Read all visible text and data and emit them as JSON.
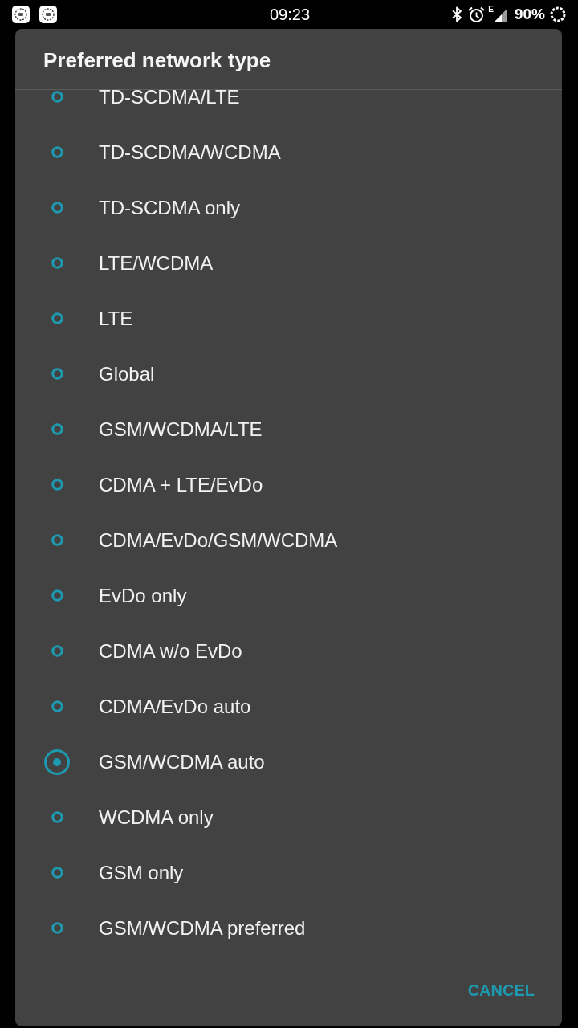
{
  "status_bar": {
    "time": "09:23",
    "network_type": "E",
    "battery": "90%"
  },
  "dialog": {
    "title": "Preferred network type",
    "options": [
      {
        "label": "TD-SCDMA/LTE",
        "selected": false
      },
      {
        "label": "TD-SCDMA/WCDMA",
        "selected": false
      },
      {
        "label": "TD-SCDMA only",
        "selected": false
      },
      {
        "label": "LTE/WCDMA",
        "selected": false
      },
      {
        "label": "LTE",
        "selected": false
      },
      {
        "label": "Global",
        "selected": false
      },
      {
        "label": "GSM/WCDMA/LTE",
        "selected": false
      },
      {
        "label": "CDMA + LTE/EvDo",
        "selected": false
      },
      {
        "label": "CDMA/EvDo/GSM/WCDMA",
        "selected": false
      },
      {
        "label": "EvDo only",
        "selected": false
      },
      {
        "label": "CDMA w/o EvDo",
        "selected": false
      },
      {
        "label": "CDMA/EvDo auto",
        "selected": false
      },
      {
        "label": "GSM/WCDMA auto",
        "selected": true
      },
      {
        "label": "WCDMA only",
        "selected": false
      },
      {
        "label": "GSM only",
        "selected": false
      },
      {
        "label": "GSM/WCDMA preferred",
        "selected": false
      }
    ],
    "buttons": [
      {
        "label": "CANCEL"
      }
    ]
  }
}
